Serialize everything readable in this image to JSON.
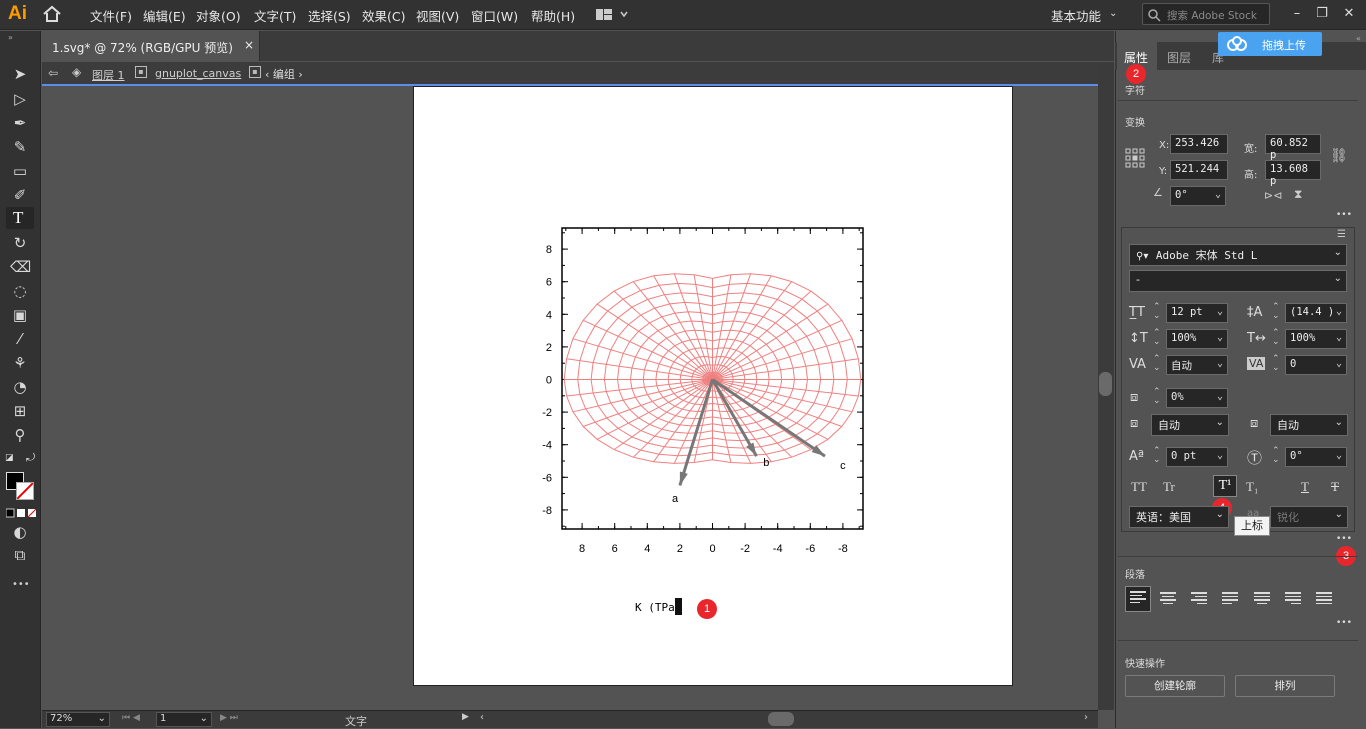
{
  "app": {
    "logo": "Ai",
    "workspace": "基本功能",
    "search_placeholder": "搜索 Adobe Stock"
  },
  "menu": [
    "文件(F)",
    "编辑(E)",
    "对象(O)",
    "文字(T)",
    "选择(S)",
    "效果(C)",
    "视图(V)",
    "窗口(W)",
    "帮助(H)"
  ],
  "document": {
    "tab_title": "1.svg* @ 72% (RGB/GPU 预览)",
    "close": "×"
  },
  "breadcrumb": {
    "layer": "图层 1",
    "canvas": "gnuplot_canvas",
    "group": "编组"
  },
  "chart": {
    "y_ticks": [
      "8",
      "6",
      "4",
      "2",
      "0",
      "-2",
      "-4",
      "-6",
      "-8"
    ],
    "x_ticks": [
      "8",
      "6",
      "4",
      "2",
      "0",
      "-2",
      "-4",
      "-6",
      "-8"
    ],
    "arrow_labels": [
      "a",
      "b",
      "c"
    ],
    "axis_text": "K (TPa)",
    "accent": "#f08080"
  },
  "status": {
    "zoom": "72%",
    "page": "1",
    "tool": "文字"
  },
  "panel": {
    "tabs": [
      "属性",
      "图层",
      "库"
    ],
    "upload_label": "拖拽上传",
    "section_char": "字符",
    "section_transform": "变换",
    "x_label": "X:",
    "x_value": "253.426",
    "y_label": "Y:",
    "y_value": "521.244",
    "w_label": "宽:",
    "w_value": "60.852 p",
    "h_label": "高:",
    "h_value": "13.608 p",
    "angle": "0°",
    "font_family": "Adobe 宋体 Std L",
    "font_style": "-",
    "font_size": "12 pt",
    "leading": "(14.4 )",
    "vscale": "100%",
    "hscale": "100%",
    "kerning": "自动",
    "tracking": "0",
    "tsume": "0%",
    "aki_left": "自动",
    "aki_right": "自动",
    "baseline": "0 pt",
    "rotation": "0°",
    "language": "英语：美国",
    "aa": "锐化",
    "tooltip": "上标",
    "section_para": "段落",
    "section_quick": "快速操作",
    "btn_outline": "创建轮廓",
    "btn_arrange": "排列",
    "more": "•••"
  },
  "badges": [
    "1",
    "2",
    "3",
    "4"
  ],
  "text_styles": [
    "TT",
    "Tr",
    "T¹",
    "T₁",
    "T",
    "T"
  ]
}
